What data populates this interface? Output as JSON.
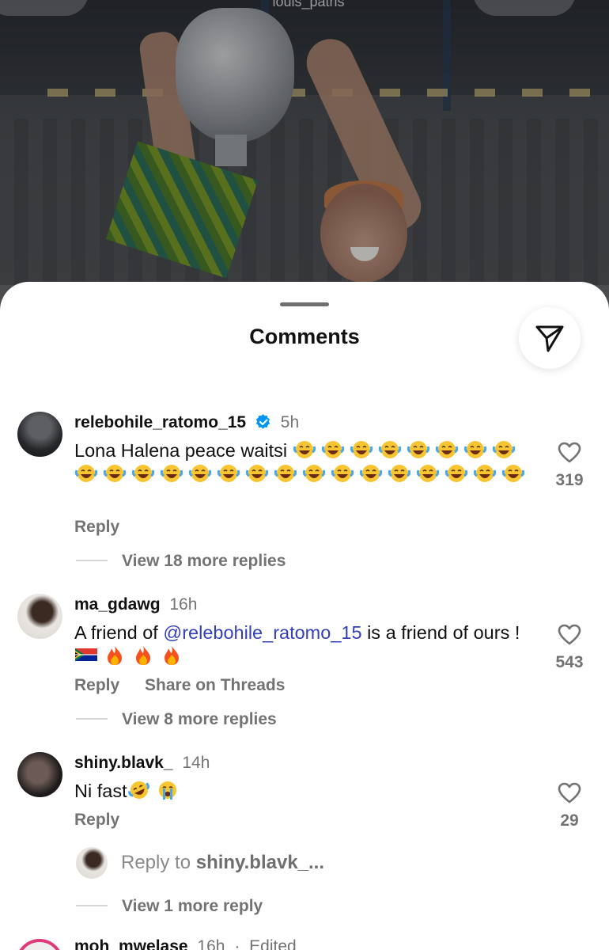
{
  "post": {
    "owner_label": "louis_patris"
  },
  "sheet": {
    "title": "Comments",
    "share_icon": "paper-plane-icon"
  },
  "comments": [
    {
      "username": "relebohile_ratomo_15",
      "verified": true,
      "time": "5h",
      "text": "Lona Halena peace waitsi",
      "emoji": "face-with-tears-of-joy",
      "emoji_count": 24,
      "likes": "319",
      "reply_label": "Reply",
      "view_replies": "View 18 more replies"
    },
    {
      "username": "ma_gdawg",
      "time": "16h",
      "text_before": "A friend of ",
      "mention": "@relebohile_ratomo_15",
      "text_after": " is a friend of ours ! ",
      "emojis": [
        "flag-south-africa",
        "fire",
        "fire",
        "fire"
      ],
      "likes": "543",
      "reply_label": "Reply",
      "share_threads_label": "Share on Threads",
      "view_replies": "View 8 more replies"
    },
    {
      "username": "shiny.blavk_",
      "time": "14h",
      "text": "Ni fast",
      "emojis": [
        "rolling-on-the-floor-laughing",
        "loudly-crying-face"
      ],
      "likes": "29",
      "reply_label": "Reply",
      "reply_to_prefix": "Reply to ",
      "reply_to_user": "shiny.blavk_...",
      "view_replies": "View 1 more reply"
    },
    {
      "username": "moh_mwelase",
      "time": "16h",
      "edited": "Edited"
    }
  ],
  "colors": {
    "text": "#111111",
    "muted": "#737373",
    "mention": "#3340b8",
    "verified": "#0095f6",
    "story_ring": "#e03a7a"
  }
}
